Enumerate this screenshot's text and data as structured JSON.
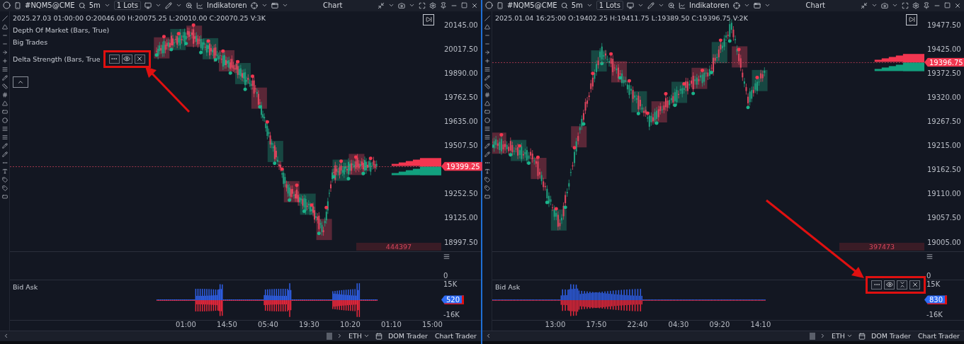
{
  "panes": [
    {
      "toolbar": {
        "symbol": "#NQM5@CME",
        "timeframe": "5m",
        "lots": "1 Lots",
        "indicators": "Indikatoren",
        "title": "Chart"
      },
      "ohlc": "2025.27.03 01:00:00 O:20046.00 H:20075.25 L:20010.00 C:20070.25 V:3K",
      "legend": [
        {
          "text": "Depth Of Market (Bars, True)"
        },
        {
          "text": "Big Trades"
        },
        {
          "text": "Delta Strength (Bars, True",
          "controls": {
            "highlighted": true,
            "items": [
              {
                "kind": "settings"
              },
              {
                "kind": "visibility"
              },
              {
                "kind": "close"
              }
            ]
          }
        }
      ],
      "price_ticks": [
        "20145.00",
        "20017.50",
        "19890.00",
        "19762.50",
        "19635.00",
        "19507.50",
        "19252.50",
        "19125.00",
        "18997.50"
      ],
      "last_price": "19399.25",
      "volume": "444397",
      "zero_label": "0",
      "bid_ask": {
        "label": "Bid Ask",
        "top": "15K",
        "bottom": "-16K",
        "value": "520"
      },
      "time_ticks": [
        "01:00",
        "14:50",
        "05:40",
        "19:30",
        "10:20",
        "01:10",
        "15:00"
      ],
      "bottom_bar": {
        "session": "ETH",
        "buttons": [
          "DOM Trader",
          "Chart Trader"
        ]
      }
    },
    {
      "toolbar": {
        "symbol": "#NQM5@CME",
        "timeframe": "5m",
        "lots": "1 Lots",
        "indicators": "Indikatoren",
        "title": "Chart"
      },
      "ohlc": "2025.01.04 16:25:00 O:19402.25 H:19411.75 L:19389.50 C:19396.75 V:2K",
      "price_ticks": [
        "19477.50",
        "19425.00",
        "19372.50",
        "19320.00",
        "19267.50",
        "19215.00",
        "19162.50",
        "19110.00",
        "19057.50",
        "19005.00"
      ],
      "last_price": "19396.75",
      "volume": "397473",
      "zero_label": "0",
      "bid_ask": {
        "label": "Bid Ask",
        "top": "15K",
        "bottom": "-16K",
        "value": "830",
        "controls": {
          "highlighted": true,
          "items": [
            {
              "kind": "settings"
            },
            {
              "kind": "visibility"
            },
            {
              "kind": "collapse"
            },
            {
              "kind": "close"
            }
          ]
        }
      },
      "time_ticks": [
        "13:00",
        "17:50",
        "22:40",
        "04:30",
        "09:20",
        "14:10"
      ],
      "bottom_bar": {
        "session": "ETH",
        "buttons": [
          "DOM Trader",
          "Chart Trader"
        ]
      }
    }
  ]
}
